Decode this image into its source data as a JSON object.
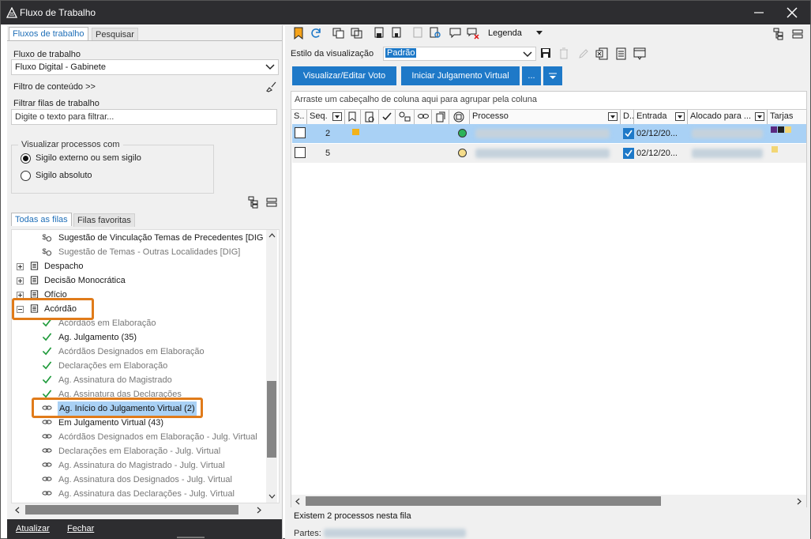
{
  "window": {
    "title": "Fluxo de Trabalho"
  },
  "left": {
    "tabs": [
      "Fluxos de trabalho",
      "Pesquisar"
    ],
    "workflow_label": "Fluxo de trabalho",
    "workflow_value": "Fluxo Digital - Gabinete",
    "content_filter": "Filtro de conteúdo >>",
    "queue_filter_label": "Filtrar filas de trabalho",
    "queue_filter_placeholder": "Digite o texto para filtrar...",
    "view_group_label": "Visualizar processos com",
    "radio_1": "Sigilo externo ou sem sigilo",
    "radio_2": "Sigilo absoluto",
    "queue_tabs": [
      "Todas as filas",
      "Filas favoritas"
    ],
    "tree": [
      "Sugestão de Vinculação Temas de Precedentes [DIG",
      "Sugestão de Temas - Outras Localidades [DIG]",
      "Despacho",
      "Decisão Monocrática",
      "Ofício",
      "Acórdão",
      "Acórdãos em Elaboração",
      "Ag. Julgamento (35)",
      "Acórdãos Designados em Elaboração",
      "Declarações em Elaboração",
      "Ag. Assinatura do Magistrado",
      "Ag. Assinatura das Declarações",
      "Ag. Início do Julgamento Virtual (2)",
      "Em Julgamento Virtual (43)",
      "Acórdãos Designados em Elaboração - Julg. Virtual",
      "Declarações em Elaboração - Julg. Virtual",
      "Ag. Assinatura do Magistrado - Julg. Virtual",
      "Ag. Assinatura dos Designados - Julg. Virtual",
      "Ag. Assinatura das Declarações - Julg. Virtual"
    ],
    "bottom": {
      "update": "Atualizar",
      "close": "Fechar"
    }
  },
  "right": {
    "toolbar": {
      "legend": "Legenda"
    },
    "view_style_label": "Estilo da visualização",
    "view_style_value": "Padrão",
    "buttons": {
      "view_edit": "Visualizar/Editar Voto",
      "start_virtual": "Iniciar Julgamento Virtual",
      "more": "..."
    },
    "group_hint": "Arraste um cabeçalho de coluna aqui para agrupar pela coluna",
    "columns": {
      "s": "S..",
      "seq": "Seq.",
      "processo": "Processo",
      "d": "D..",
      "entrada": "Entrada",
      "alocado": "Alocado para ...",
      "tarjas": "Tarjas"
    },
    "rows": [
      {
        "seq": "2",
        "entrada": "02/12/20..."
      },
      {
        "seq": "5",
        "entrada": "02/12/20..."
      }
    ],
    "status": "Existem 2 processos nesta fila",
    "parts_label": "Partes:"
  },
  "colors": {
    "accent": "#1e79c8",
    "highlight": "#e07b1a",
    "titlebar": "#2d2d30",
    "selected_row": "#a9d1f5"
  }
}
